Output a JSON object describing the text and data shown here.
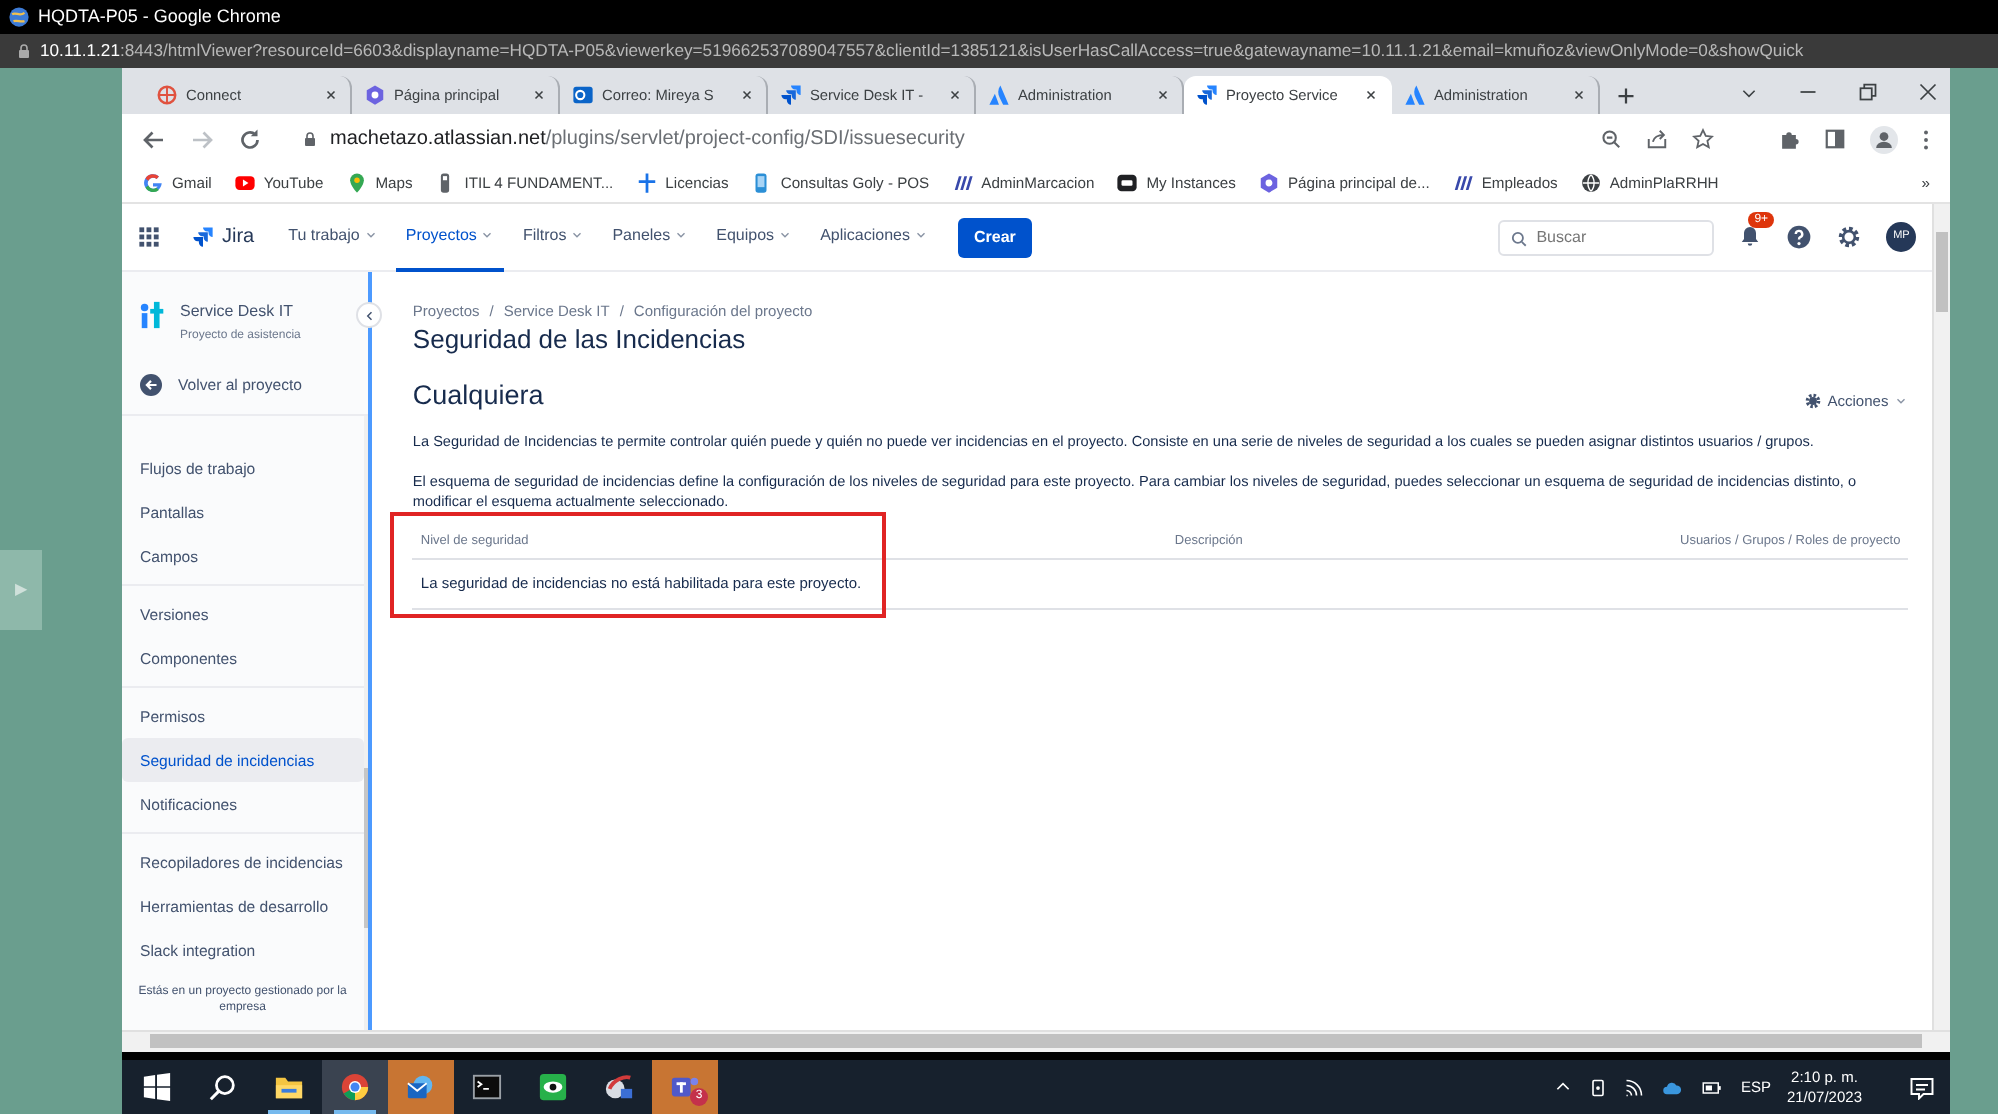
{
  "remote": {
    "title": "HQDTA-P05 - Google Chrome",
    "url_host": "10.11.1.21",
    "url_rest": ":8443/htmlViewer?resourceId=6603&displayname=HQDTA-P05&viewerkey=519662537089047557&clientId=1385121&isUserHasCallAccess=true&gatewayname=10.11.1.21&email=kmuñoz&viewOnlyMode=0&showQuick",
    "side_toggle": "▶"
  },
  "tabs": [
    {
      "kind": "connect",
      "label": "Connect",
      "selected": false
    },
    {
      "kind": "sites",
      "label": "Página principal",
      "selected": false
    },
    {
      "kind": "outlook",
      "label": "Correo: Mireya S",
      "selected": false
    },
    {
      "kind": "jira",
      "label": "Service Desk IT -",
      "selected": false
    },
    {
      "kind": "atlassian",
      "label": "Administration",
      "selected": false
    },
    {
      "kind": "jira",
      "label": "Proyecto Service",
      "selected": true
    },
    {
      "kind": "atlassian",
      "label": "Administration",
      "selected": false
    }
  ],
  "address": {
    "host": "machetazo.atlassian.net",
    "path": "/plugins/servlet/project-config/SDI/issuesecurity"
  },
  "bookmarks": [
    {
      "kind": "google",
      "label": "Gmail"
    },
    {
      "kind": "youtube",
      "label": "YouTube"
    },
    {
      "kind": "maps",
      "label": "Maps"
    },
    {
      "kind": "doc",
      "label": "ITIL 4 FUNDAMENT..."
    },
    {
      "kind": "plus",
      "label": "Licencias"
    },
    {
      "kind": "phone",
      "label": "Consultas Goly - POS"
    },
    {
      "kind": "stripes",
      "label": "AdminMarcacion"
    },
    {
      "kind": "square",
      "label": "My Instances"
    },
    {
      "kind": "sites",
      "label": "Página principal de..."
    },
    {
      "kind": "stripes",
      "label": "Empleados"
    },
    {
      "kind": "globe",
      "label": "AdminPlaRRHH"
    }
  ],
  "bookmarks_more": "»",
  "jira_nav": {
    "product": "Jira",
    "menus": [
      {
        "label": "Tu trabajo",
        "selected": false
      },
      {
        "label": "Proyectos",
        "selected": true
      },
      {
        "label": "Filtros",
        "selected": false
      },
      {
        "label": "Paneles",
        "selected": false
      },
      {
        "label": "Equipos",
        "selected": false
      },
      {
        "label": "Aplicaciones",
        "selected": false
      }
    ],
    "create": "Crear",
    "search_placeholder": "Buscar",
    "notification_badge": "9+",
    "avatar": "MP"
  },
  "sidebar": {
    "project_name": "Service Desk IT",
    "project_type": "Proyecto de asistencia",
    "back": "Volver al proyecto",
    "groups": [
      {
        "items": [
          {
            "label": "Flujos de trabajo",
            "selected": false
          },
          {
            "label": "Pantallas",
            "selected": false
          },
          {
            "label": "Campos",
            "selected": false
          }
        ]
      },
      {
        "items": [
          {
            "label": "Versiones",
            "selected": false
          },
          {
            "label": "Componentes",
            "selected": false
          }
        ]
      },
      {
        "items": [
          {
            "label": "Permisos",
            "selected": false
          },
          {
            "label": "Seguridad de incidencias",
            "selected": true
          },
          {
            "label": "Notificaciones",
            "selected": false
          }
        ]
      },
      {
        "items": [
          {
            "label": "Recopiladores de incidencias",
            "selected": false
          },
          {
            "label": "Herramientas de desarrollo",
            "selected": false
          },
          {
            "label": "Slack integration",
            "selected": false
          }
        ]
      }
    ],
    "footer": "Estás en un proyecto gestionado por la empresa"
  },
  "main": {
    "breadcrumbs": [
      "Proyectos",
      "Service Desk IT",
      "Configuración del proyecto"
    ],
    "separator": "/",
    "title": "Seguridad de las Incidencias",
    "scheme": "Cualquiera",
    "actions": "Acciones",
    "paragraphs": [
      "La Seguridad de Incidencias te permite controlar quién puede y quién no puede ver incidencias en el proyecto. Consiste en una serie de niveles de seguridad a los cuales se pueden asignar distintos usuarios / grupos.",
      "El esquema de seguridad de incidencias define la configuración de los niveles de seguridad para este proyecto. Para cambiar los niveles de seguridad, puedes seleccionar un esquema de seguridad de incidencias distinto, o modificar el esquema actualmente seleccionado."
    ],
    "table": {
      "columns": [
        "Nivel de seguridad",
        "Descripción",
        "Usuarios / Grupos / Roles de proyecto"
      ],
      "empty_message": "La seguridad de incidencias no está habilitada para este proyecto.",
      "highlighted": true
    }
  },
  "taskbar": {
    "apps": [
      {
        "kind": "start",
        "open": false,
        "focused": false,
        "flashing": false
      },
      {
        "kind": "search",
        "open": false,
        "focused": false,
        "flashing": false
      },
      {
        "kind": "folder",
        "open": true,
        "focused": false,
        "flashing": false
      },
      {
        "kind": "chrome",
        "open": true,
        "focused": true,
        "flashing": false
      },
      {
        "kind": "mail",
        "open": false,
        "focused": false,
        "flashing": true
      },
      {
        "kind": "terminal",
        "open": false,
        "focused": false,
        "flashing": false
      },
      {
        "kind": "eye",
        "open": false,
        "focused": false,
        "flashing": false
      },
      {
        "kind": "remote",
        "open": false,
        "focused": false,
        "flashing": false
      },
      {
        "kind": "teams",
        "open": false,
        "focused": false,
        "flashing": true,
        "badge": "3"
      }
    ],
    "language": "ESP",
    "time": "2:10 p. m.",
    "date": "21/07/2023"
  }
}
